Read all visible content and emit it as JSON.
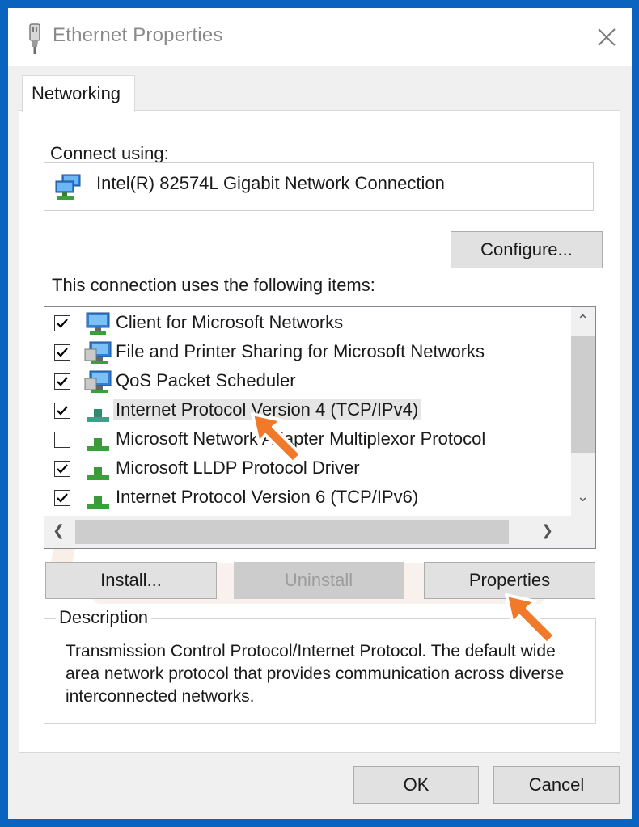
{
  "window": {
    "title": "Ethernet Properties"
  },
  "tabs": [
    {
      "label": "Networking"
    }
  ],
  "connect_using": {
    "label": "Connect using:",
    "adapter_name": "Intel(R) 82574L Gigabit Network Connection",
    "configure_label": "Configure..."
  },
  "items_section": {
    "label": "This connection uses the following items:",
    "items": [
      {
        "label": "Client for Microsoft Networks",
        "checked": true,
        "icon": "network-client-icon"
      },
      {
        "label": "File and Printer Sharing for Microsoft Networks",
        "checked": true,
        "icon": "network-service-icon"
      },
      {
        "label": "QoS Packet Scheduler",
        "checked": true,
        "icon": "network-service-icon"
      },
      {
        "label": "Internet Protocol Version 4 (TCP/IPv4)",
        "checked": true,
        "icon": "protocol-icon",
        "selected": true
      },
      {
        "label": "Microsoft Network Adapter Multiplexor Protocol",
        "checked": false,
        "icon": "protocol-icon"
      },
      {
        "label": "Microsoft LLDP Protocol Driver",
        "checked": true,
        "icon": "protocol-icon"
      },
      {
        "label": "Internet Protocol Version 6 (TCP/IPv6)",
        "checked": true,
        "icon": "protocol-icon"
      }
    ]
  },
  "actions": {
    "install_label": "Install...",
    "uninstall_label": "Uninstall",
    "properties_label": "Properties"
  },
  "description": {
    "title": "Description",
    "text": "Transmission Control Protocol/Internet Protocol. The default wide area network protocol that provides communication across diverse interconnected networks."
  },
  "footer": {
    "ok_label": "OK",
    "cancel_label": "Cancel"
  },
  "colors": {
    "background": "#0a63bf",
    "pointer": "#f07a2a",
    "selection": "#e5e5e5"
  }
}
